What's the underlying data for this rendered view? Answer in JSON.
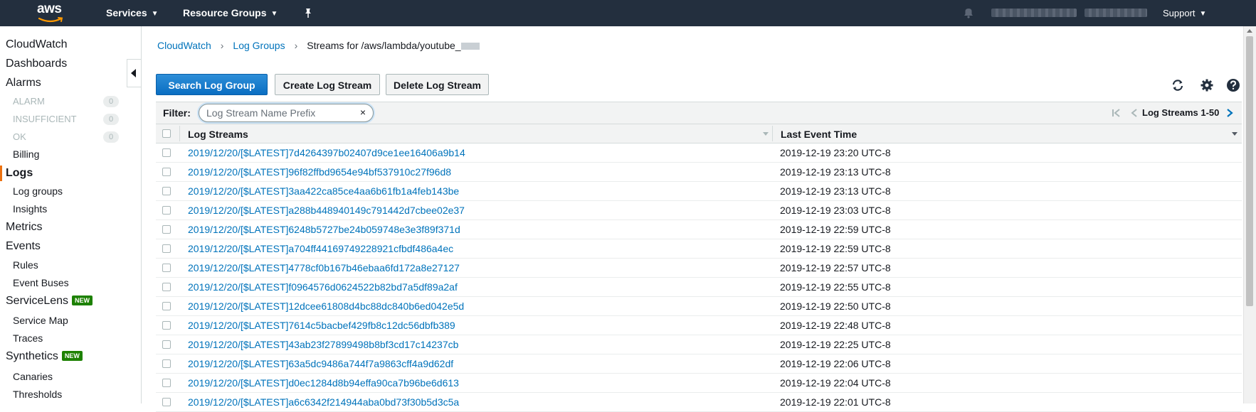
{
  "topnav": {
    "logo": "aws",
    "services_label": "Services",
    "resource_groups_label": "Resource Groups",
    "support_label": "Support"
  },
  "sidebar": {
    "cloudwatch": "CloudWatch",
    "dashboards": "Dashboards",
    "alarms": "Alarms",
    "alarm_states": [
      {
        "label": "ALARM",
        "count": "0"
      },
      {
        "label": "INSUFFICIENT",
        "count": "0"
      },
      {
        "label": "OK",
        "count": "0"
      }
    ],
    "billing": "Billing",
    "logs": "Logs",
    "log_groups": "Log groups",
    "insights": "Insights",
    "metrics": "Metrics",
    "events": "Events",
    "rules": "Rules",
    "event_buses": "Event Buses",
    "servicelens": "ServiceLens",
    "new_badge": "NEW",
    "service_map": "Service Map",
    "traces": "Traces",
    "synthetics": "Synthetics",
    "canaries": "Canaries",
    "thresholds": "Thresholds"
  },
  "breadcrumb": {
    "cloudwatch": "CloudWatch",
    "log_groups": "Log Groups",
    "current": "Streams for /aws/lambda/youtube_"
  },
  "toolbar": {
    "search_log_group": "Search Log Group",
    "create_log_stream": "Create Log Stream",
    "delete_log_stream": "Delete Log Stream"
  },
  "filter": {
    "label": "Filter:",
    "placeholder": "Log Stream Name Prefix",
    "value": "",
    "clear": "×",
    "pager_text": "Log Streams 1-50"
  },
  "table": {
    "columns": [
      "Log Streams",
      "Last Event Time"
    ],
    "rows": [
      {
        "stream": "2019/12/20/[$LATEST]7d4264397b02407d9ce1ee16406a9b14",
        "time": "2019-12-19 23:20 UTC-8"
      },
      {
        "stream": "2019/12/20/[$LATEST]96f82ffbd9654e94bf537910c27f96d8",
        "time": "2019-12-19 23:13 UTC-8"
      },
      {
        "stream": "2019/12/20/[$LATEST]3aa422ca85ce4aa6b61fb1a4feb143be",
        "time": "2019-12-19 23:13 UTC-8"
      },
      {
        "stream": "2019/12/20/[$LATEST]a288b448940149c791442d7cbee02e37",
        "time": "2019-12-19 23:03 UTC-8"
      },
      {
        "stream": "2019/12/20/[$LATEST]6248b5727be24b059748e3e3f89f371d",
        "time": "2019-12-19 22:59 UTC-8"
      },
      {
        "stream": "2019/12/20/[$LATEST]a704ff44169749228921cfbdf486a4ec",
        "time": "2019-12-19 22:59 UTC-8"
      },
      {
        "stream": "2019/12/20/[$LATEST]4778cf0b167b46ebaa6fd172a8e27127",
        "time": "2019-12-19 22:57 UTC-8"
      },
      {
        "stream": "2019/12/20/[$LATEST]f0964576d0624522b82bd7a5df89a2af",
        "time": "2019-12-19 22:55 UTC-8"
      },
      {
        "stream": "2019/12/20/[$LATEST]12dcee61808d4bc88dc840b6ed042e5d",
        "time": "2019-12-19 22:50 UTC-8"
      },
      {
        "stream": "2019/12/20/[$LATEST]7614c5bacbef429fb8c12dc56dbfb389",
        "time": "2019-12-19 22:48 UTC-8"
      },
      {
        "stream": "2019/12/20/[$LATEST]43ab23f27899498b8bf3cd17c14237cb",
        "time": "2019-12-19 22:25 UTC-8"
      },
      {
        "stream": "2019/12/20/[$LATEST]63a5dc9486a744f7a9863cff4a9d62df",
        "time": "2019-12-19 22:06 UTC-8"
      },
      {
        "stream": "2019/12/20/[$LATEST]d0ec1284d8b94effa90ca7b96be6d613",
        "time": "2019-12-19 22:04 UTC-8"
      },
      {
        "stream": "2019/12/20/[$LATEST]a6c6342f214944aba0bd73f30b5d3c5a",
        "time": "2019-12-19 22:01 UTC-8"
      }
    ]
  },
  "colors": {
    "nav_bg": "#232f3e",
    "link": "#0073bb",
    "primary_button": "#0972d3",
    "active_accent": "#ec7211",
    "new_badge": "#1d8102"
  }
}
